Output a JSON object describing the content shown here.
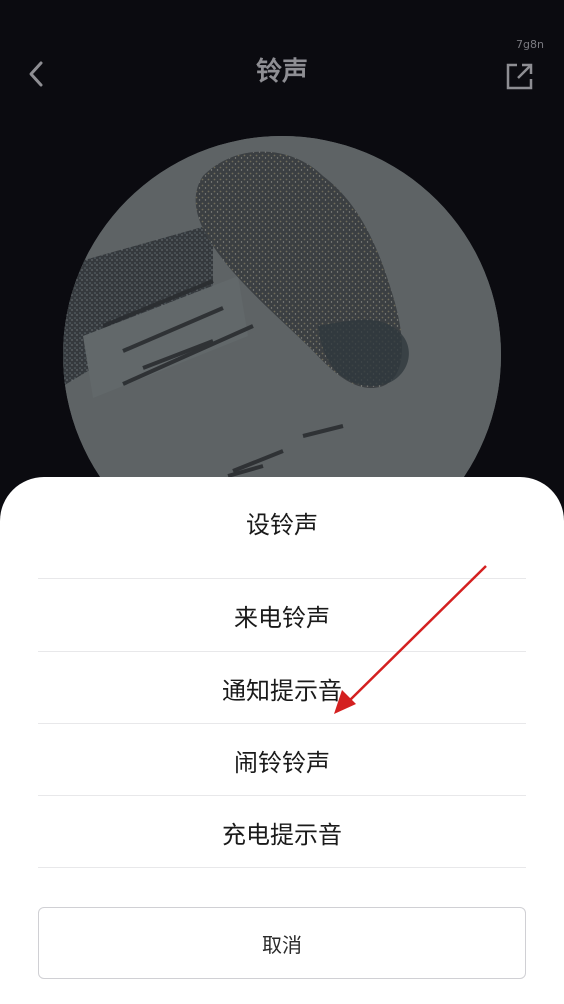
{
  "header": {
    "title": "铃声",
    "corner_tag": "7g8n",
    "back_icon": "chevron-left-icon",
    "share_icon": "share-external-icon"
  },
  "sheet": {
    "title": "设铃声",
    "options": [
      {
        "label": "来电铃声"
      },
      {
        "label": "通知提示音"
      },
      {
        "label": "闹铃铃声"
      },
      {
        "label": "充电提示音"
      }
    ],
    "cancel_label": "取消"
  },
  "colors": {
    "background": "#0b0b10",
    "title": "#8e8e93",
    "sheet": "#ffffff",
    "annotation_arrow": "#d42020"
  }
}
